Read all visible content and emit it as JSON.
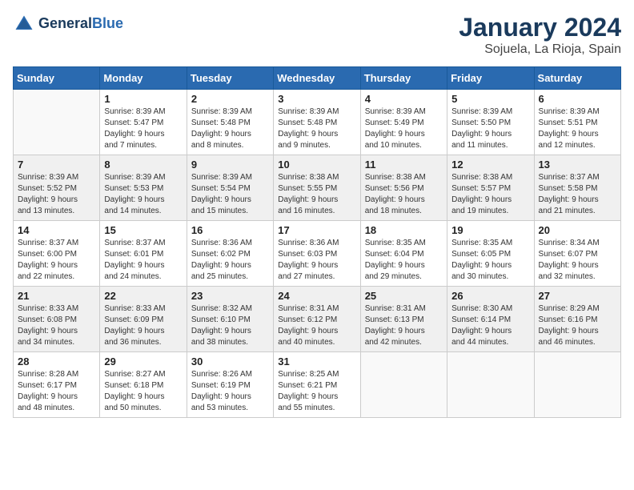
{
  "logo": {
    "line1": "General",
    "line2": "Blue"
  },
  "title": "January 2024",
  "subtitle": "Sojuela, La Rioja, Spain",
  "days_of_week": [
    "Sunday",
    "Monday",
    "Tuesday",
    "Wednesday",
    "Thursday",
    "Friday",
    "Saturday"
  ],
  "weeks": [
    [
      {
        "day": "",
        "info": ""
      },
      {
        "day": "1",
        "info": "Sunrise: 8:39 AM\nSunset: 5:47 PM\nDaylight: 9 hours\nand 7 minutes."
      },
      {
        "day": "2",
        "info": "Sunrise: 8:39 AM\nSunset: 5:48 PM\nDaylight: 9 hours\nand 8 minutes."
      },
      {
        "day": "3",
        "info": "Sunrise: 8:39 AM\nSunset: 5:48 PM\nDaylight: 9 hours\nand 9 minutes."
      },
      {
        "day": "4",
        "info": "Sunrise: 8:39 AM\nSunset: 5:49 PM\nDaylight: 9 hours\nand 10 minutes."
      },
      {
        "day": "5",
        "info": "Sunrise: 8:39 AM\nSunset: 5:50 PM\nDaylight: 9 hours\nand 11 minutes."
      },
      {
        "day": "6",
        "info": "Sunrise: 8:39 AM\nSunset: 5:51 PM\nDaylight: 9 hours\nand 12 minutes."
      }
    ],
    [
      {
        "day": "7",
        "info": "Sunrise: 8:39 AM\nSunset: 5:52 PM\nDaylight: 9 hours\nand 13 minutes."
      },
      {
        "day": "8",
        "info": "Sunrise: 8:39 AM\nSunset: 5:53 PM\nDaylight: 9 hours\nand 14 minutes."
      },
      {
        "day": "9",
        "info": "Sunrise: 8:39 AM\nSunset: 5:54 PM\nDaylight: 9 hours\nand 15 minutes."
      },
      {
        "day": "10",
        "info": "Sunrise: 8:38 AM\nSunset: 5:55 PM\nDaylight: 9 hours\nand 16 minutes."
      },
      {
        "day": "11",
        "info": "Sunrise: 8:38 AM\nSunset: 5:56 PM\nDaylight: 9 hours\nand 18 minutes."
      },
      {
        "day": "12",
        "info": "Sunrise: 8:38 AM\nSunset: 5:57 PM\nDaylight: 9 hours\nand 19 minutes."
      },
      {
        "day": "13",
        "info": "Sunrise: 8:37 AM\nSunset: 5:58 PM\nDaylight: 9 hours\nand 21 minutes."
      }
    ],
    [
      {
        "day": "14",
        "info": "Sunrise: 8:37 AM\nSunset: 6:00 PM\nDaylight: 9 hours\nand 22 minutes."
      },
      {
        "day": "15",
        "info": "Sunrise: 8:37 AM\nSunset: 6:01 PM\nDaylight: 9 hours\nand 24 minutes."
      },
      {
        "day": "16",
        "info": "Sunrise: 8:36 AM\nSunset: 6:02 PM\nDaylight: 9 hours\nand 25 minutes."
      },
      {
        "day": "17",
        "info": "Sunrise: 8:36 AM\nSunset: 6:03 PM\nDaylight: 9 hours\nand 27 minutes."
      },
      {
        "day": "18",
        "info": "Sunrise: 8:35 AM\nSunset: 6:04 PM\nDaylight: 9 hours\nand 29 minutes."
      },
      {
        "day": "19",
        "info": "Sunrise: 8:35 AM\nSunset: 6:05 PM\nDaylight: 9 hours\nand 30 minutes."
      },
      {
        "day": "20",
        "info": "Sunrise: 8:34 AM\nSunset: 6:07 PM\nDaylight: 9 hours\nand 32 minutes."
      }
    ],
    [
      {
        "day": "21",
        "info": "Sunrise: 8:33 AM\nSunset: 6:08 PM\nDaylight: 9 hours\nand 34 minutes."
      },
      {
        "day": "22",
        "info": "Sunrise: 8:33 AM\nSunset: 6:09 PM\nDaylight: 9 hours\nand 36 minutes."
      },
      {
        "day": "23",
        "info": "Sunrise: 8:32 AM\nSunset: 6:10 PM\nDaylight: 9 hours\nand 38 minutes."
      },
      {
        "day": "24",
        "info": "Sunrise: 8:31 AM\nSunset: 6:12 PM\nDaylight: 9 hours\nand 40 minutes."
      },
      {
        "day": "25",
        "info": "Sunrise: 8:31 AM\nSunset: 6:13 PM\nDaylight: 9 hours\nand 42 minutes."
      },
      {
        "day": "26",
        "info": "Sunrise: 8:30 AM\nSunset: 6:14 PM\nDaylight: 9 hours\nand 44 minutes."
      },
      {
        "day": "27",
        "info": "Sunrise: 8:29 AM\nSunset: 6:16 PM\nDaylight: 9 hours\nand 46 minutes."
      }
    ],
    [
      {
        "day": "28",
        "info": "Sunrise: 8:28 AM\nSunset: 6:17 PM\nDaylight: 9 hours\nand 48 minutes."
      },
      {
        "day": "29",
        "info": "Sunrise: 8:27 AM\nSunset: 6:18 PM\nDaylight: 9 hours\nand 50 minutes."
      },
      {
        "day": "30",
        "info": "Sunrise: 8:26 AM\nSunset: 6:19 PM\nDaylight: 9 hours\nand 53 minutes."
      },
      {
        "day": "31",
        "info": "Sunrise: 8:25 AM\nSunset: 6:21 PM\nDaylight: 9 hours\nand 55 minutes."
      },
      {
        "day": "",
        "info": ""
      },
      {
        "day": "",
        "info": ""
      },
      {
        "day": "",
        "info": ""
      }
    ]
  ]
}
